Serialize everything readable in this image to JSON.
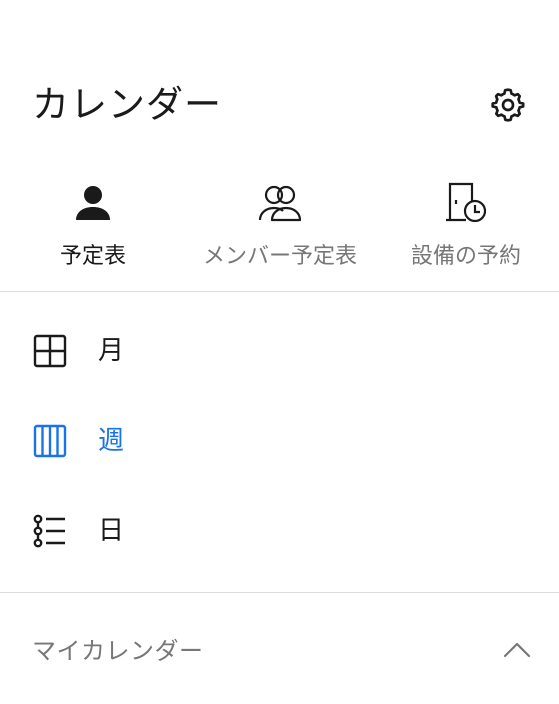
{
  "header": {
    "title": "カレンダー",
    "settings_icon": "gear-icon"
  },
  "views": [
    {
      "label": "予定表",
      "icon": "person-icon",
      "active": true
    },
    {
      "label": "メンバー予定表",
      "icon": "people-icon",
      "active": false
    },
    {
      "label": "設備の予約",
      "icon": "door-clock-icon",
      "active": false
    }
  ],
  "modes": [
    {
      "label": "月",
      "icon": "month-grid-icon",
      "selected": false
    },
    {
      "label": "週",
      "icon": "week-columns-icon",
      "selected": true
    },
    {
      "label": "日",
      "icon": "day-list-icon",
      "selected": false
    }
  ],
  "section": {
    "label": "マイカレンダー",
    "icon": "chevron-up-icon"
  },
  "colors": {
    "accent": "#1a73e8",
    "text": "#1a1a1a",
    "muted": "#777777",
    "divider": "#dddddd"
  }
}
